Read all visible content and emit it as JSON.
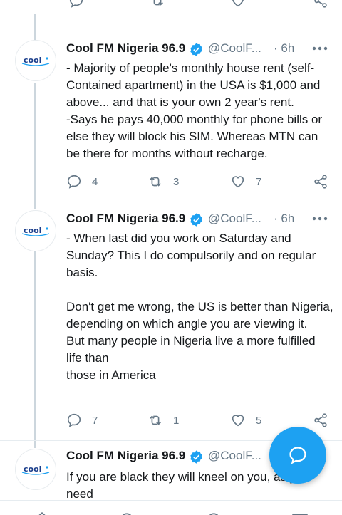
{
  "tweets": [
    {
      "name": "Cool FM Nigeria 96.9",
      "handle": "@CoolF...",
      "time": "· 6h",
      "text": "- Majority of people's monthly house rent (self-Contained apartment) in the USA is $1,000 and above... and that is your own 2 year's rent.\n-Says he pays 40,000 monthly for phone bills or else they will block his SIM. Whereas MTN can be there for months without recharge.",
      "replies": "4",
      "retweets": "3",
      "likes": "7"
    },
    {
      "name": "Cool FM Nigeria 96.9",
      "handle": "@CoolF...",
      "time": "· 6h",
      "text": "- When last did you work on Saturday and Sunday? This I do compulsorily and on regular basis.\n\nDon't get me wrong, the US is better than Nigeria,\ndepending on which angle you are viewing it.\nBut many people in Nigeria live a more fulfilled life than\nthose in America",
      "replies": "7",
      "retweets": "1",
      "likes": "5"
    },
    {
      "name": "Cool FM Nigeria 96.9",
      "handle": "@CoolF...",
      "text": "If you are black they will kneel on you, as you need"
    }
  ],
  "avatar_logo": "cool",
  "colors": {
    "accent": "#1da1f2",
    "secondary_text": "#657786",
    "icon_gray": "#657786",
    "thread_line": "#ccd6dd"
  },
  "icons": {
    "reply": "reply-icon",
    "retweet": "retweet-icon",
    "like": "like-icon",
    "share": "share-icon",
    "verified": "verified-badge-icon",
    "more": "more-options-icon",
    "compose": "compose-message-icon"
  }
}
